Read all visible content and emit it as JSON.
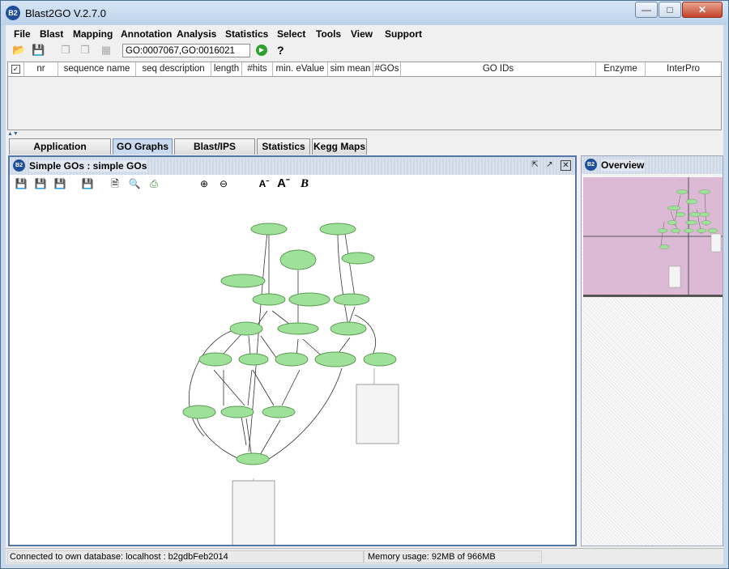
{
  "window": {
    "title": "Blast2GO V.2.7.0",
    "icon": "b2g-logo-icon"
  },
  "menu": [
    "File",
    "Blast",
    "Mapping",
    "Annotation",
    "Analysis",
    "Statistics",
    "Select",
    "Tools",
    "View",
    "Support"
  ],
  "toolbar": {
    "go_filter_value": "GO:0007067,GO:0016021"
  },
  "table": {
    "columns": [
      "nr",
      "sequence name",
      "seq description",
      "length",
      "#hits",
      "min. eValue",
      "sim mean",
      "#GOs",
      "GO IDs",
      "Enzyme",
      "InterPro"
    ]
  },
  "tabs": [
    "Application Messages",
    "GO Graphs",
    "Blast/IPS Results",
    "Statistics",
    "Kegg Maps"
  ],
  "active_tab": "GO Graphs",
  "graph_pane": {
    "title": "Simple GOs : simple GOs"
  },
  "overview_pane": {
    "title": "Overview"
  },
  "colors": {
    "node_fill": "#9fe09a",
    "node_stroke": "#5a9a52",
    "overview_bg": "#dcbad6"
  },
  "status": {
    "connection": "Connected to own database: localhost : b2gdbFeb2014",
    "memory": "Memory usage: 92MB of 966MB"
  }
}
